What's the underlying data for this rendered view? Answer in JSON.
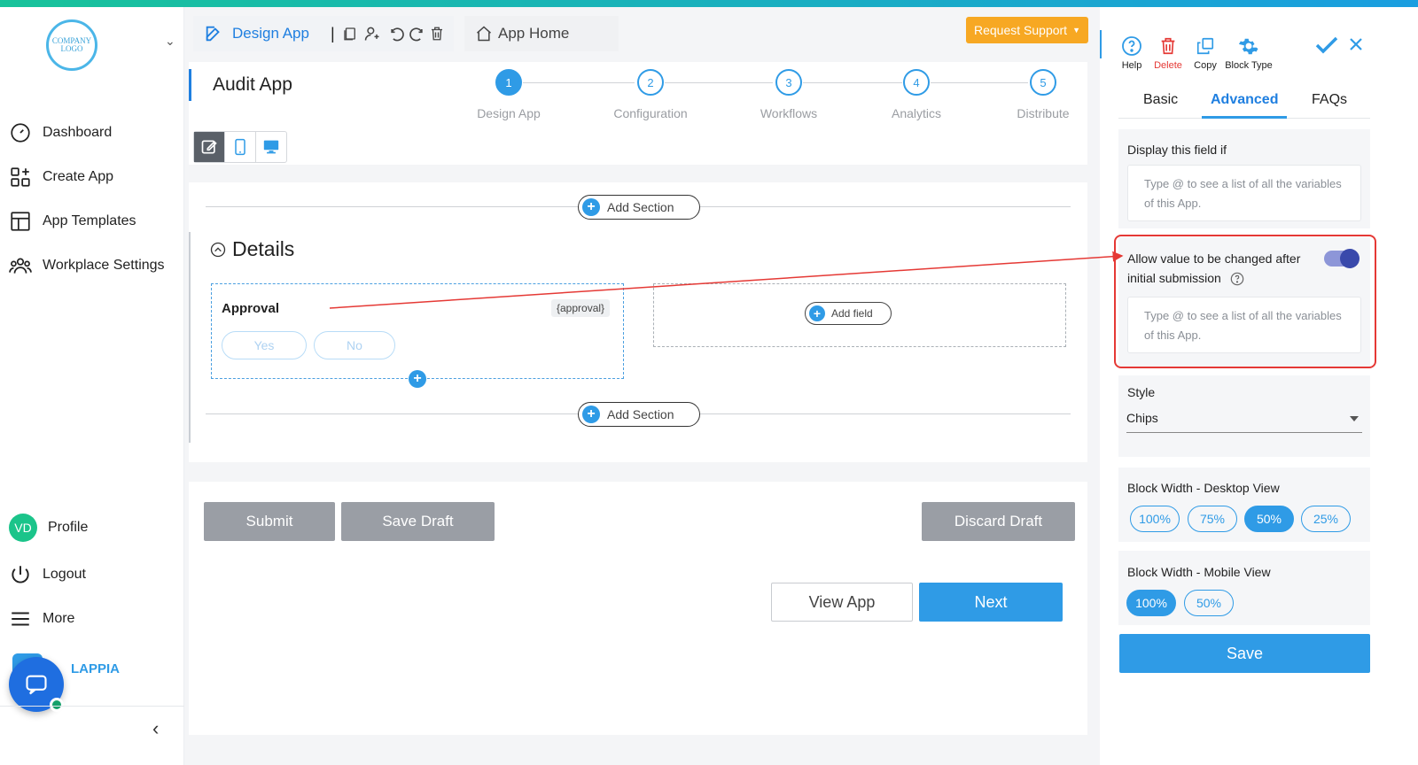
{
  "sidebar": {
    "logo_text": "COMPANY LOGO",
    "items": [
      {
        "label": "Dashboard"
      },
      {
        "label": "Create App"
      },
      {
        "label": "App Templates"
      },
      {
        "label": "Workplace Settings"
      }
    ],
    "profile": {
      "initials": "VD",
      "label": "Profile"
    },
    "logout_label": "Logout",
    "more_label": "More",
    "brand_text": "LAPPIA"
  },
  "header": {
    "design_tab": "Design App",
    "home_tab": "App Home",
    "request_support": "Request Support"
  },
  "app": {
    "title": "Audit App",
    "steps": [
      {
        "num": "1",
        "label": "Design App"
      },
      {
        "num": "2",
        "label": "Configuration"
      },
      {
        "num": "3",
        "label": "Workflows"
      },
      {
        "num": "4",
        "label": "Analytics"
      },
      {
        "num": "5",
        "label": "Distribute"
      }
    ]
  },
  "canvas": {
    "add_section": "Add Section",
    "section_title": "Details",
    "field": {
      "label": "Approval",
      "tag": "{approval}",
      "options": [
        "Yes",
        "No"
      ]
    },
    "add_field": "Add field"
  },
  "actions": {
    "submit": "Submit",
    "save_draft": "Save Draft",
    "discard_draft": "Discard Draft",
    "view_app": "View App",
    "next": "Next"
  },
  "panel": {
    "tools": [
      {
        "label": "Help"
      },
      {
        "label": "Delete"
      },
      {
        "label": "Copy"
      },
      {
        "label": "Block Type"
      }
    ],
    "tabs": [
      "Basic",
      "Advanced",
      "FAQs"
    ],
    "display_if": {
      "title": "Display this field if",
      "placeholder": "Type @ to see a list of all the variables of this App."
    },
    "allow_change": {
      "title": "Allow value to be changed after initial submission",
      "placeholder": "Type @ to see a list of all the variables of this App.",
      "enabled": true
    },
    "style": {
      "title": "Style",
      "value": "Chips"
    },
    "desktop_width": {
      "title": "Block Width - Desktop View",
      "options": [
        "100%",
        "75%",
        "50%",
        "25%"
      ],
      "selected": "50%"
    },
    "mobile_width": {
      "title": "Block Width - Mobile View",
      "options": [
        "100%",
        "50%"
      ],
      "selected": "100%"
    },
    "save": "Save"
  },
  "colors": {
    "accent": "#2f9be6",
    "warning": "#f7a823",
    "annotation": "#e53935"
  }
}
